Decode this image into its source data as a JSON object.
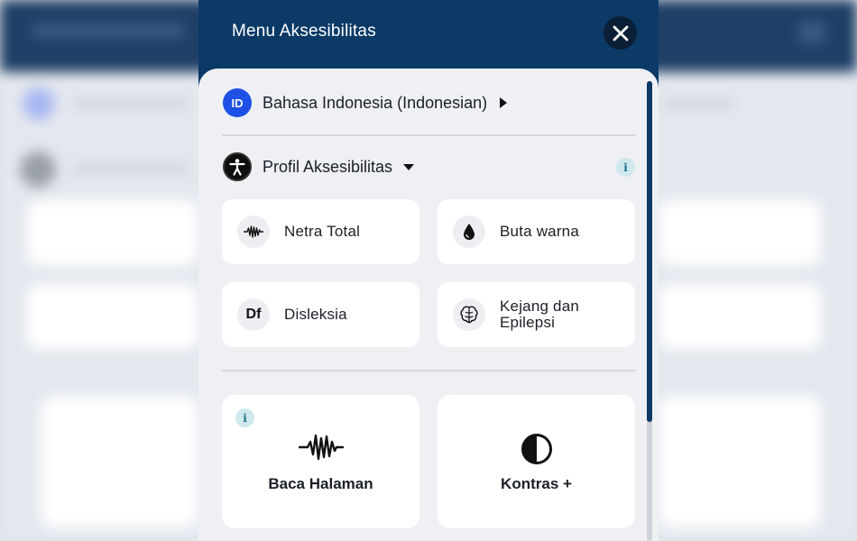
{
  "panel": {
    "title": "Menu Aksesibilitas",
    "close_icon": "close-icon"
  },
  "language": {
    "code": "ID",
    "label": "Bahasa Indonesia (Indonesian)"
  },
  "profile": {
    "label": "Profil Aksesibilitas",
    "info": "i",
    "cards": [
      {
        "label": "Netra Total",
        "icon": "sound-wave-icon"
      },
      {
        "label": "Buta warna",
        "icon": "water-drop-icon"
      },
      {
        "label": "Disleksia",
        "icon_text": "Df"
      },
      {
        "label_line1": "Kejang dan",
        "label_line2": "Epilepsi",
        "icon": "brain-icon"
      }
    ]
  },
  "tools": {
    "info": "i",
    "cards": [
      {
        "label": "Baca Halaman",
        "icon": "sound-wave-icon"
      },
      {
        "label": "Kontras +",
        "icon": "contrast-icon"
      }
    ]
  },
  "colors": {
    "panel_header": "#0b3a66",
    "language_badge": "#1e50e6",
    "content_bg": "#eef0f4"
  }
}
